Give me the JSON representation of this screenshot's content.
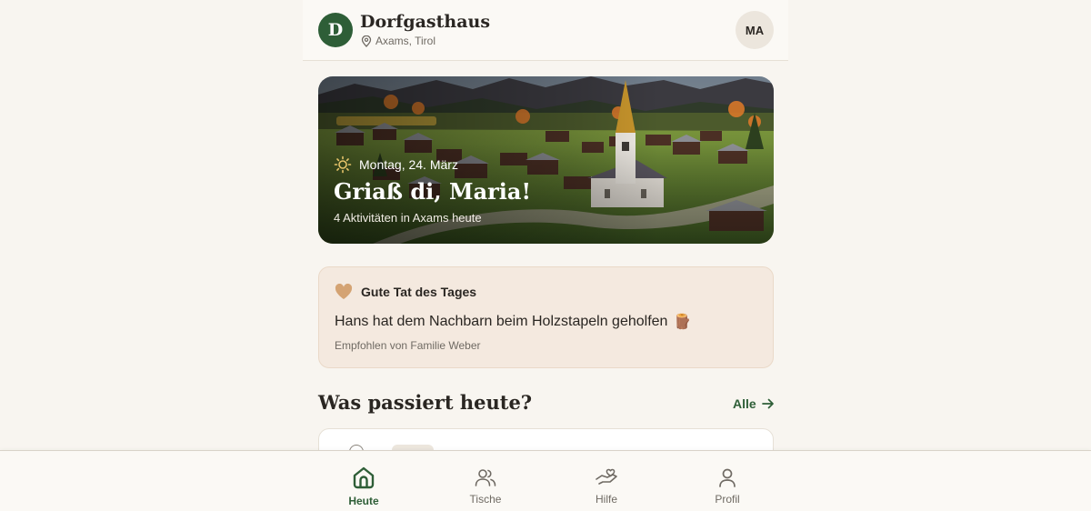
{
  "header": {
    "logo_letter": "D",
    "brand_name": "Dorfgasthaus",
    "location": "Axams, Tirol",
    "avatar_initials": "MA"
  },
  "hero": {
    "date": "Montag, 24. März",
    "greeting": "Griaß di, Maria!",
    "subtitle": "4 Aktivitäten in Axams heute"
  },
  "good_deed": {
    "title": "Gute Tat des Tages",
    "text": "Hans hat dem Nachbarn beim Holzstapeln geholfen",
    "emoji": "🪵",
    "recommended_by": "Empfohlen von Familie Weber"
  },
  "today": {
    "title": "Was passiert heute?",
    "link_label": "Alle"
  },
  "bottom_nav": {
    "items": [
      {
        "label": "Heute",
        "icon": "home-icon",
        "active": true
      },
      {
        "label": "Tische",
        "icon": "people-icon",
        "active": false
      },
      {
        "label": "Hilfe",
        "icon": "helping-hand-icon",
        "active": false
      },
      {
        "label": "Profil",
        "icon": "user-icon",
        "active": false
      }
    ]
  },
  "colors": {
    "brand_green": "#2e5e37",
    "background": "#f8f5f0",
    "deed_background": "#f4e9df",
    "heart": "#d4a373"
  }
}
